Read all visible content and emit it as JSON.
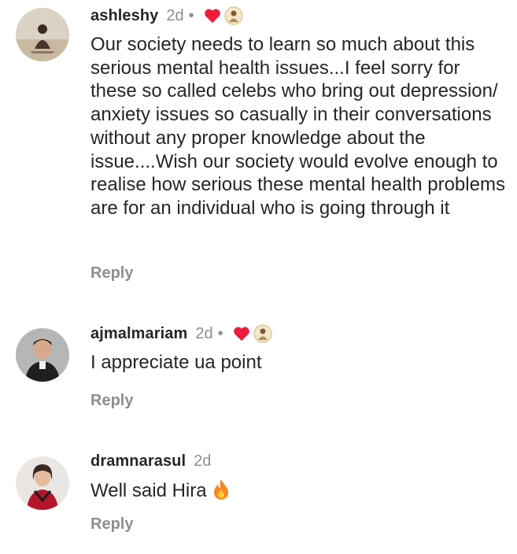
{
  "comments": [
    {
      "username": "ashleshy",
      "time": "2d",
      "dot": "•",
      "text": "Our society needs to learn so much about this serious mental health issues...I feel sorry for these so called celebs who bring out depression/ anxiety issues so casually in their conversations without any proper knowledge about the issue....Wish our society would evolve enough to realise how serious these mental health problems are for an individual who is going through it",
      "reply_label": "Reply",
      "liked_by_author": true,
      "icons": [
        "heart-icon",
        "author-avatar-icon"
      ]
    },
    {
      "username": "ajmalmariam",
      "time": "2d",
      "dot": "•",
      "text": "I appreciate ua point",
      "reply_label": "Reply",
      "liked_by_author": true,
      "icons": [
        "heart-icon",
        "author-avatar-icon"
      ]
    },
    {
      "username": "dramnarasul",
      "time": "2d",
      "text": "Well said Hira",
      "reply_label": "Reply",
      "liked_by_author": false,
      "icons": [
        "fire-icon"
      ]
    }
  ],
  "colors": {
    "text": "#262626",
    "muted": "#8e8e8e",
    "heart": "#ed1c3c"
  }
}
